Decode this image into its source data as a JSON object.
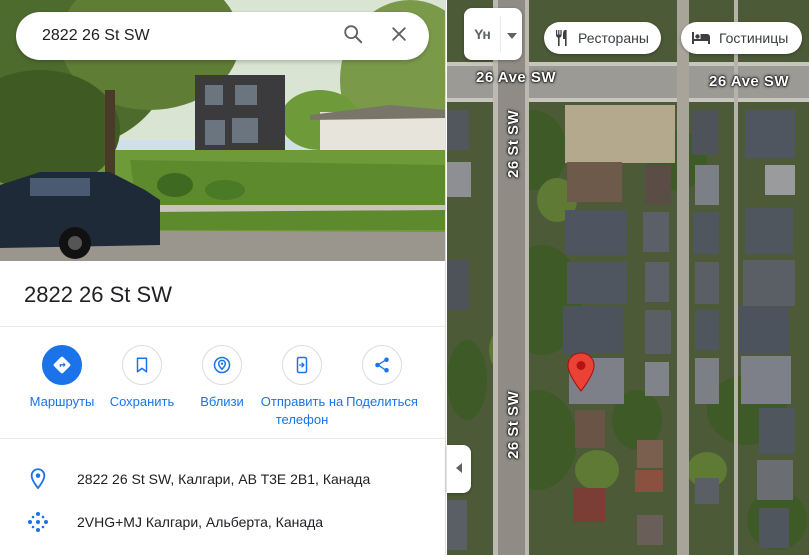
{
  "search": {
    "value": "2822 26 St SW",
    "search_icon": "search-icon",
    "close_icon": "close-icon"
  },
  "place": {
    "title": "2822 26 St SW"
  },
  "actions": [
    {
      "label": "Маршруты",
      "icon": "directions-icon"
    },
    {
      "label": "Сохранить",
      "icon": "bookmark-icon"
    },
    {
      "label": "Вблизи",
      "icon": "nearby-icon"
    },
    {
      "label": "Отправить на телефон",
      "icon": "send-to-phone-icon"
    },
    {
      "label": "Поделиться",
      "icon": "share-icon"
    }
  ],
  "info": {
    "address": "2822 26 St SW, Калгари, AB T3E 2B1, Канада",
    "plus_code": "2VHG+MJ Калгари, Альберта, Канада"
  },
  "map": {
    "layer_label": "Yн",
    "chips": [
      {
        "label": "Рестораны",
        "icon": "restaurant-icon"
      },
      {
        "label": "Гостиницы",
        "icon": "hotel-icon"
      }
    ],
    "streets": {
      "avenue_left": "26 Ave SW",
      "avenue_right": "26 Ave SW",
      "street_top": "26 St SW",
      "street_bottom": "26 St SW"
    }
  },
  "colors": {
    "accent": "#1a73e8",
    "pin": "#ea4335",
    "text": "#202124"
  }
}
